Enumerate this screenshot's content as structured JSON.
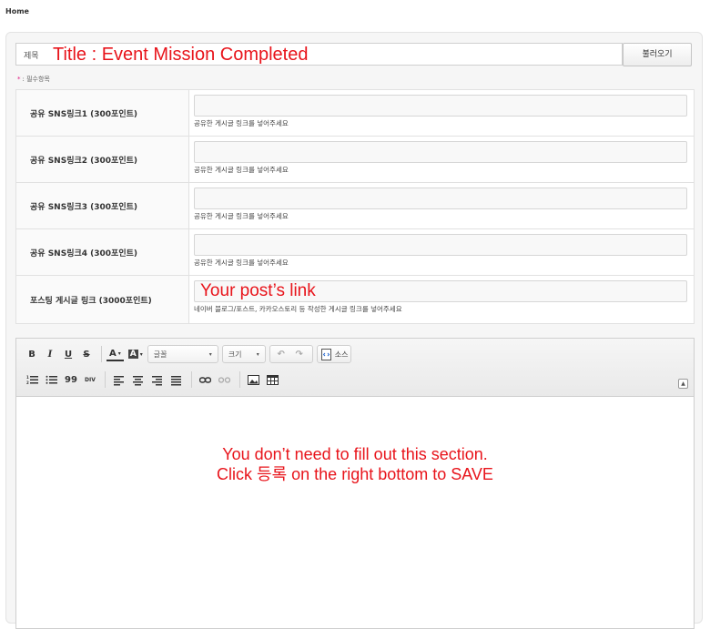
{
  "breadcrumb": "Home",
  "title_field": {
    "prefix": "제목",
    "overlay": "Title : Event Mission Completed"
  },
  "load_button": "불러오기",
  "required_note": {
    "star": "*",
    "text": ": 필수항목"
  },
  "fields": [
    {
      "label": "공유 SNS링크1 (300포인트)",
      "help": "공유한 게시글 링크를 넣어주세요"
    },
    {
      "label": "공유 SNS링크2 (300포인트)",
      "help": "공유한 게시글 링크를 넣어주세요"
    },
    {
      "label": "공유 SNS링크3 (300포인트)",
      "help": "공유한 게시글 링크를 넣어주세요"
    },
    {
      "label": "공유 SNS링크4 (300포인트)",
      "help": "공유한 게시글 링크를 넣어주세요"
    },
    {
      "label": "포스팅 게시글 링크 (3000포인트)",
      "help": "네이버 블로그/포스트, 카카오스토리 등 작성한 게시글 링크를 넣어주세요",
      "overlay": "Your post’s link"
    }
  ],
  "toolbar": {
    "bold": "B",
    "italic": "I",
    "underline": "U",
    "strike": "S",
    "text_color": "A",
    "bg_color": "A",
    "font_combo": "글꼴",
    "size_combo": "크기",
    "source": "소스",
    "blockquote": "99",
    "div": "DIV",
    "collapse": "▲"
  },
  "editor_overlay": {
    "line1": "You don’t need to fill out this section.",
    "line2": "Click 등록 on the right bottom to SAVE"
  },
  "colors": {
    "annotation_red": "#e8141b",
    "required_star": "#e0147f"
  }
}
